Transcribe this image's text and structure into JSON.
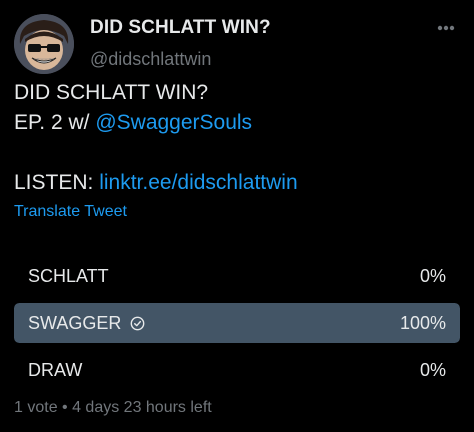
{
  "author": {
    "display_name": "DID SCHLATT WIN?",
    "handle": "@didschlattwin",
    "avatar_icon": "cartoon-face-avatar"
  },
  "tweet": {
    "line1": "DID SCHLATT WIN?",
    "line2_prefix": "EP. 2 w/ ",
    "line2_mention": "@SwaggerSouls",
    "line3_prefix": "LISTEN: ",
    "line3_link": "linktr.ee/didschlattwin"
  },
  "translate_label": "Translate Tweet",
  "poll": {
    "options": [
      {
        "label": "SCHLATT",
        "percent_text": "0%",
        "fraction": 0.0,
        "winner": false
      },
      {
        "label": "SWAGGER",
        "percent_text": "100%",
        "fraction": 1.0,
        "winner": true
      },
      {
        "label": "DRAW",
        "percent_text": "0%",
        "fraction": 0.0,
        "winner": false
      }
    ],
    "summary": "1 vote • 4 days 23 hours left"
  },
  "colors": {
    "background": "#000000",
    "text": "#e7e9ea",
    "secondary": "#71767b",
    "link": "#1d9bf0",
    "poll_fill": "#435566"
  }
}
